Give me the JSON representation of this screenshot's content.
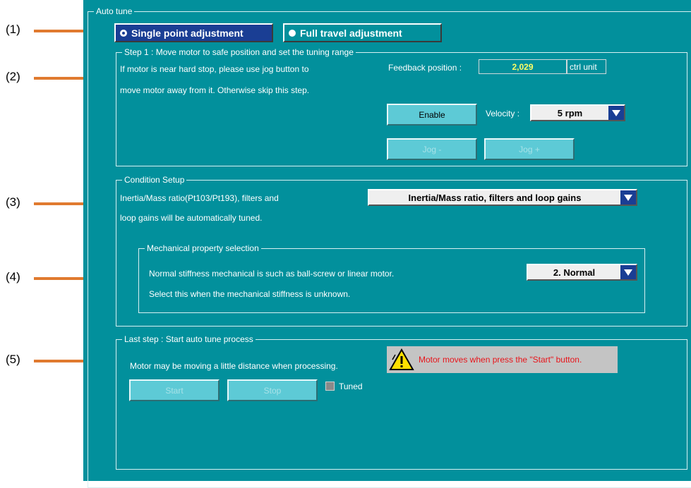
{
  "callouts": [
    "(1)",
    "(2)",
    "(3)",
    "(4)",
    "(5)"
  ],
  "colors": {
    "panel_bg": "#02909c",
    "selected_bg": "#1a3e94",
    "value_text": "#ffff66",
    "warning_text": "#e8141a",
    "callout_line": "#e07a2f"
  },
  "auto_tune": {
    "title": "Auto tune",
    "mode": {
      "single_label": "Single point adjustment",
      "full_label": "Full travel adjustment",
      "selected": "single"
    }
  },
  "step1": {
    "title": "Step 1 : Move motor to safe position and set the tuning range",
    "desc_line1": "If motor is near hard stop, please use jog button to",
    "desc_line2": "move motor away from it. Otherwise skip this step.",
    "feedback_label": "Feedback position :",
    "feedback_value": "2,029",
    "feedback_unit": "ctrl unit",
    "enable_label": "Enable",
    "velocity_label": "Velocity :",
    "velocity_value": "5 rpm",
    "jog_minus_label": "Jog -",
    "jog_plus_label": "Jog +"
  },
  "condition": {
    "title": "Condition Setup",
    "desc_line1": "Inertia/Mass ratio(Pt103/Pt193), filters and",
    "desc_line2": "loop gains will be automatically tuned.",
    "mode_value": "Inertia/Mass ratio, filters and loop gains"
  },
  "mechanical": {
    "title": "Mechanical property selection",
    "desc_line1": "Normal stiffness mechanical is such as ball-screw or linear motor.",
    "desc_line2": "Select this when the mechanical stiffness is unknown.",
    "value": "2. Normal"
  },
  "last_step": {
    "title": "Last step : Start auto tune process",
    "desc": "Motor may be moving a little distance when processing.",
    "warning": "Motor moves when press the \"Start\" button.",
    "warning_icon": "warning-triangle-icon",
    "start_label": "Start",
    "stop_label": "Stop",
    "tuned_label": "Tuned"
  }
}
